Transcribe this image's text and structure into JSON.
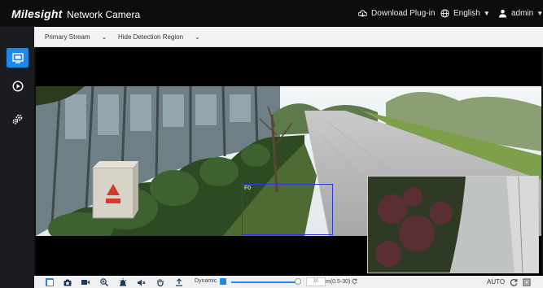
{
  "header": {
    "brand_logo": "Milesight",
    "brand_sub": "Network Camera",
    "download_plugin": "Download Plug-in",
    "language": "English",
    "user": "admin"
  },
  "sidebar": {
    "items": [
      {
        "name": "live-view",
        "icon": "monitor-icon",
        "active": true
      },
      {
        "name": "playback",
        "icon": "play-circle-icon",
        "active": false
      },
      {
        "name": "settings",
        "icon": "gears-icon",
        "active": false
      }
    ]
  },
  "controls": {
    "stream_select": "Primary Stream",
    "region_select": "Hide Detection Region"
  },
  "video": {
    "detection_label": "F0"
  },
  "toolbar": {
    "dynamic_label": "Dynamic",
    "dynamic_checked": true,
    "slider_value": "30",
    "slider_unit": "m(0.5-30)",
    "auto_label": "AUTO",
    "accent": "#1f87e8"
  }
}
